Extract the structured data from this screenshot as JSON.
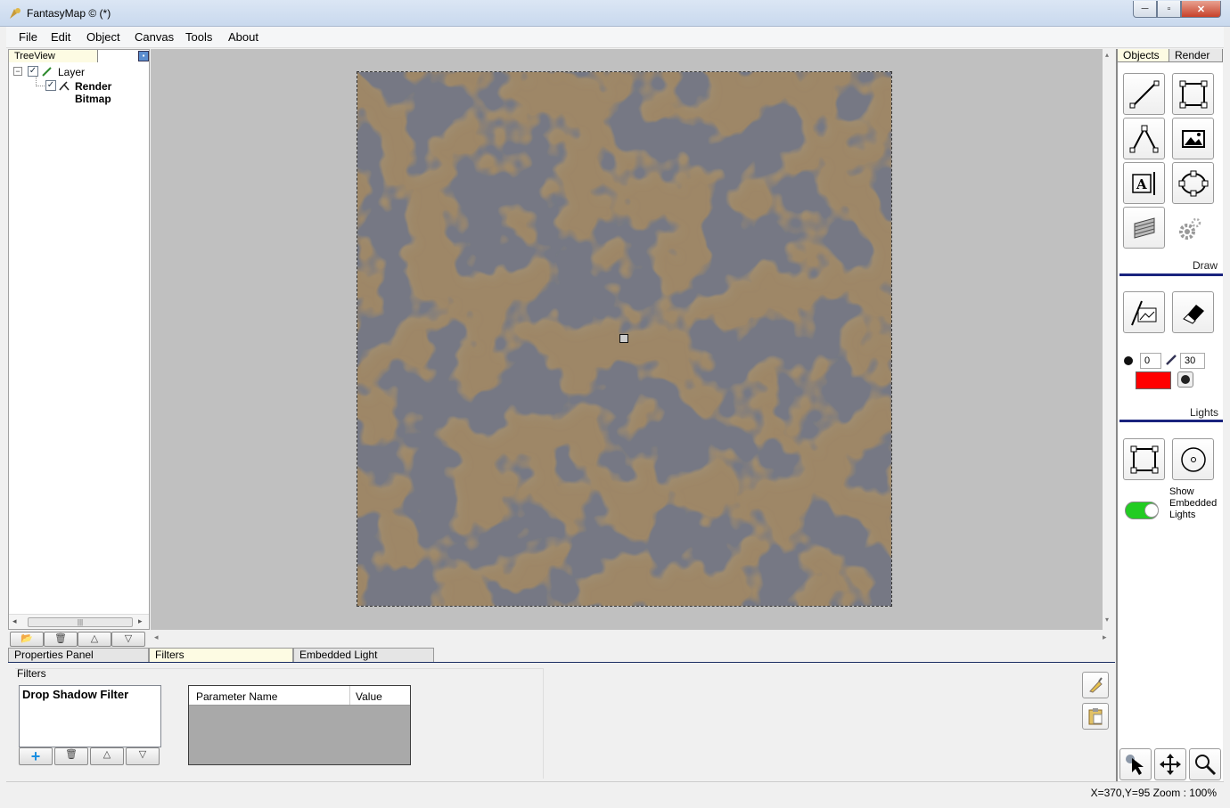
{
  "window": {
    "title": "FantasyMap © (*)",
    "min": "─",
    "max": "▫",
    "close": "✕"
  },
  "menu": [
    "File",
    "Edit",
    "Object",
    "Canvas",
    "Tools",
    "About"
  ],
  "treeview": {
    "tab": "TreeView",
    "items": [
      {
        "label": "Layer",
        "checked": true,
        "expander": "⊟"
      },
      {
        "label": "Render Bitmap",
        "checked": true
      }
    ],
    "toolbar": [
      "📂",
      "🗑",
      "△",
      "▽"
    ]
  },
  "bottom_tabs": [
    "Properties Panel",
    "Filters",
    "Embedded Light"
  ],
  "filters": {
    "legend": "Filters",
    "items": [
      "Drop Shadow Filter"
    ],
    "toolbar": [
      "+",
      "🗑",
      "△",
      "▽"
    ],
    "table_headers": [
      "Parameter Name",
      "Value"
    ]
  },
  "right_panel": {
    "tabs": [
      "Objects",
      "Render"
    ],
    "draw_label": "Draw",
    "lights_label": "Lights",
    "brush_size": "0",
    "brush_width": "30",
    "brush_color": "#ff0000",
    "show_embedded_lights_label": "Show Embedded Lights",
    "show_embedded_lights": true,
    "toggle_color": "#22cc22"
  },
  "status": {
    "text": "X=370,Y=95  Zoom : 100%"
  }
}
